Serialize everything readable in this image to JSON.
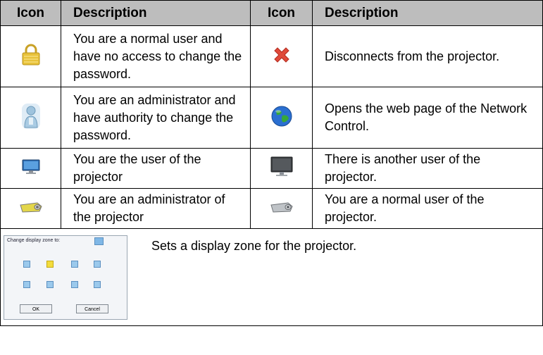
{
  "header": {
    "icon_label": "Icon",
    "description_label": "Description"
  },
  "rows": [
    {
      "left": {
        "icon": "lock-icon",
        "text": "You are a normal user and have no access to change the password."
      },
      "right": {
        "icon": "close-x-icon",
        "text": "Disconnects from the projector."
      }
    },
    {
      "left": {
        "icon": "administrator-person-icon",
        "text": "You are an administrator and have authority to change the password."
      },
      "right": {
        "icon": "globe-icon",
        "text": "Opens the web page of the Network Control."
      }
    },
    {
      "left": {
        "icon": "monitor-icon",
        "text": "You are the user of the projector"
      },
      "right": {
        "icon": "monitor-dark-icon",
        "text": "There is another user of the projector."
      }
    },
    {
      "left": {
        "icon": "projector-yellow-icon",
        "text": "You are an administrator of the projector"
      },
      "right": {
        "icon": "projector-gray-icon",
        "text": "You are a normal user of the projector."
      }
    }
  ],
  "display_zone": {
    "text": "Sets a display zone for the projector.",
    "dialog": {
      "title": "Change display zone to:",
      "ok_label": "OK",
      "cancel_label": "Cancel",
      "selected_zone": 2
    }
  },
  "colors": {
    "header_bg": "#bdbdbd",
    "lock": "#e8c23a",
    "close_x": "#e04a3a",
    "globe_blue": "#2a6fd1",
    "globe_green": "#37a83a",
    "zone": "#9bc9ec",
    "zone_selected": "#f3dc3d"
  }
}
